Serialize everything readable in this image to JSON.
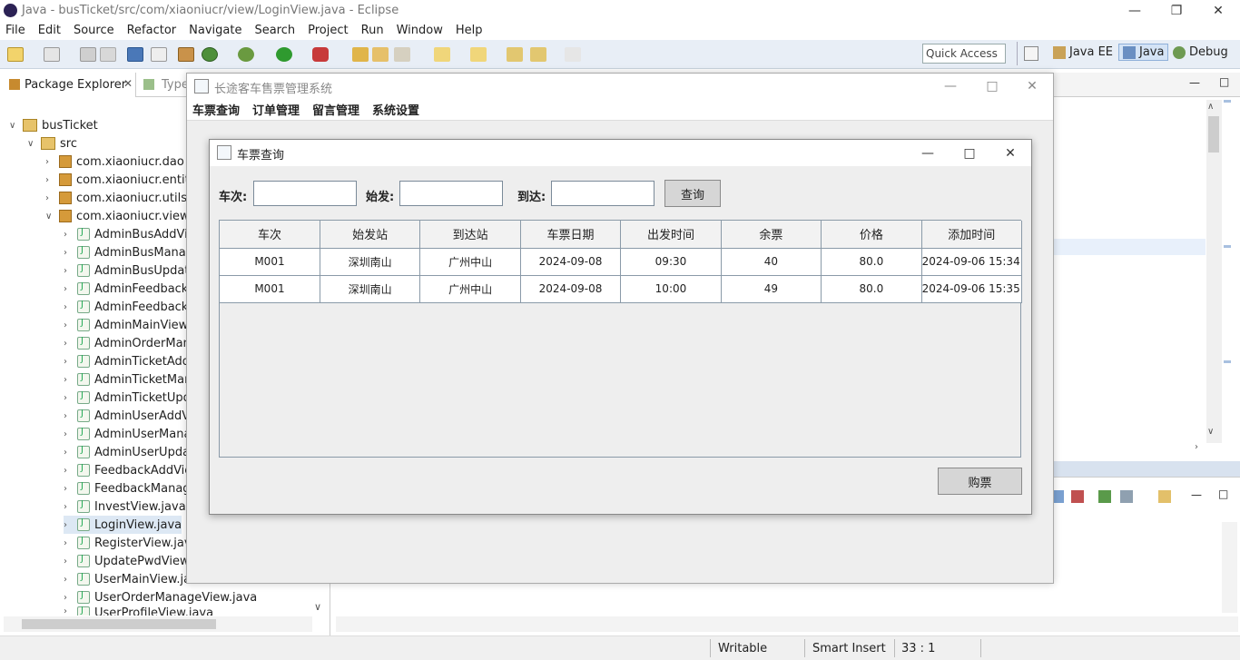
{
  "eclipse": {
    "title": "Java - busTicket/src/com/xiaoniucr/view/LoginView.java - Eclipse",
    "menu": [
      "File",
      "Edit",
      "Source",
      "Refactor",
      "Navigate",
      "Search",
      "Project",
      "Run",
      "Window",
      "Help"
    ],
    "quick_access": "Quick Access",
    "perspectives": [
      "Java EE",
      "Java",
      "Debug"
    ],
    "tabs": {
      "package_explorer": "Package Explorer",
      "type_hierarchy": "Type"
    },
    "tree": {
      "project": "busTicket",
      "src": "src",
      "packages": [
        "com.xiaoniucr.dao",
        "com.xiaoniucr.entity",
        "com.xiaoniucr.utils",
        "com.xiaoniucr.view"
      ],
      "files": [
        "AdminBusAddVie",
        "AdminBusManag",
        "AdminBusUpdate",
        "AdminFeedbackM",
        "AdminFeedbackR",
        "AdminMainView.j",
        "AdminOrderMana",
        "AdminTicketAddV",
        "AdminTicketMana",
        "AdminTicketUpda",
        "AdminUserAddVi",
        "AdminUserManag",
        "AdminUserUpdat",
        "FeedbackAddView",
        "FeedbackManage",
        "InvestView.java",
        "LoginView.java",
        "RegisterView.java",
        "UpdatePwdView.j",
        "UserMainView.java",
        "UserOrderManageView.java",
        "UserProfileView.java"
      ]
    },
    "status": {
      "writable": "Writable",
      "insert": "Smart Insert",
      "position": "33 : 1"
    }
  },
  "outer_window": {
    "title": "长途客车售票管理系统",
    "menu": [
      "车票查询",
      "订单管理",
      "留言管理",
      "系统设置"
    ]
  },
  "dialog": {
    "title": "车票查询",
    "fields": {
      "train_label": "车次:",
      "from_label": "始发:",
      "to_label": "到达:"
    },
    "query_button": "查询",
    "buy_button": "购票",
    "columns": [
      "车次",
      "始发站",
      "到达站",
      "车票日期",
      "出发时间",
      "余票",
      "价格",
      "添加时间"
    ],
    "rows": [
      [
        "M001",
        "深圳南山",
        "广州中山",
        "2024-09-08",
        "09:30",
        "40",
        "80.0",
        "2024-09-06 15:34..."
      ],
      [
        "M001",
        "深圳南山",
        "广州中山",
        "2024-09-08",
        "10:00",
        "49",
        "80.0",
        "2024-09-06 15:35..."
      ]
    ]
  }
}
